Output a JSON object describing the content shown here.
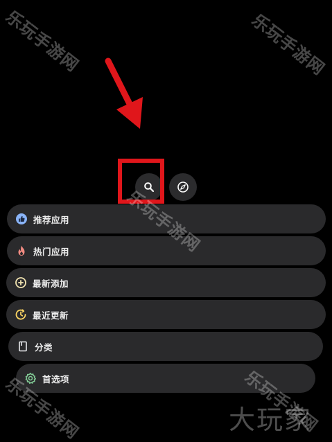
{
  "toolbar": {
    "search_icon": "search-icon",
    "explore_icon": "compass-icon"
  },
  "annotation": {
    "highlight_color": "#e0161b",
    "arrow_color": "#e0161b"
  },
  "menu": {
    "items": [
      {
        "label": "推荐应用",
        "icon": "thumbs-up-icon",
        "icon_color": "#8ab4f8"
      },
      {
        "label": "热门应用",
        "icon": "flame-icon",
        "icon_color": "#f28b82"
      },
      {
        "label": "最新添加",
        "icon": "plus-circle-icon",
        "icon_color": "#f1e3b0"
      },
      {
        "label": "最近更新",
        "icon": "update-clock-icon",
        "icon_color": "#fdd663"
      },
      {
        "label": "分类",
        "icon": "book-icon",
        "icon_color": "#e8eaed"
      },
      {
        "label": "首选项",
        "icon": "gear-icon",
        "icon_color": "#81c995"
      }
    ]
  },
  "watermarks": {
    "site_text": "乐玩手游网",
    "brand_text": "大玩家"
  }
}
